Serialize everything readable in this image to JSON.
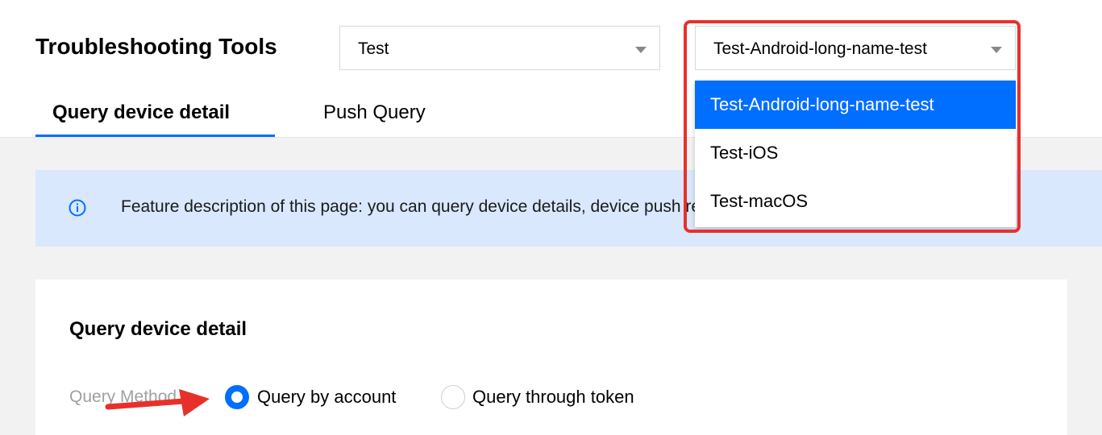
{
  "header": {
    "title": "Troubleshooting Tools",
    "app_select": {
      "value": "Test"
    },
    "platform_select": {
      "value": "Test-Android-long-name-test"
    }
  },
  "tabs": [
    {
      "label": "Query device detail",
      "active": true
    },
    {
      "label": "Push Query",
      "active": false
    }
  ],
  "notice": {
    "icon": "info-circle-icon",
    "text": "Feature description of this page: you can query device details, device push records, and account and tag through"
  },
  "dropdown": {
    "options": [
      {
        "label": "Test-Android-long-name-test",
        "selected": true
      },
      {
        "label": "Test-iOS",
        "selected": false
      },
      {
        "label": "Test-macOS",
        "selected": false
      }
    ]
  },
  "card": {
    "title": "Query device detail",
    "query_method_label": "Query Method",
    "radios": [
      {
        "label": "Query by account",
        "checked": true
      },
      {
        "label": "Query through token",
        "checked": false
      }
    ]
  },
  "colors": {
    "accent": "#006eff",
    "annotation_red": "#e8302a",
    "notice_bg": "#d9e8fd"
  }
}
